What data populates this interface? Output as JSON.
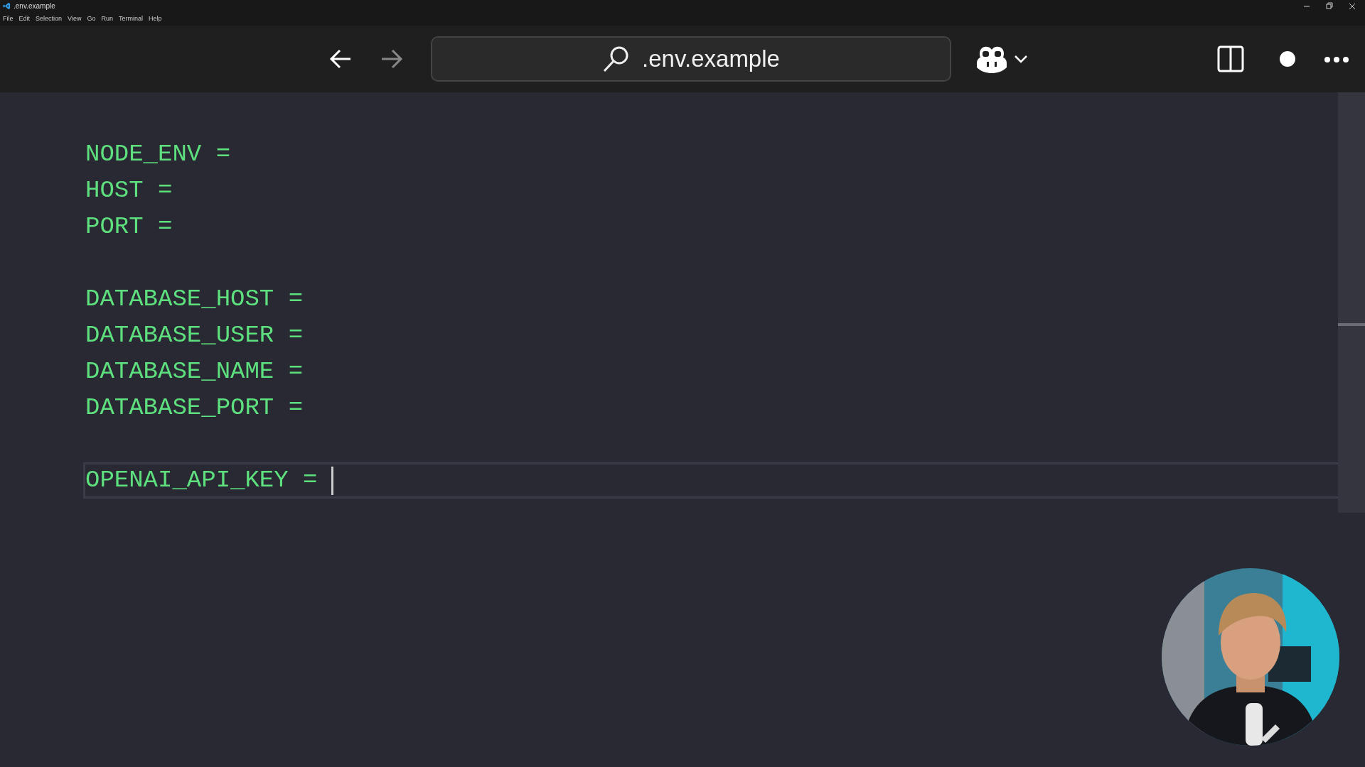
{
  "window": {
    "title": ".env.example"
  },
  "menu": [
    "File",
    "Edit",
    "Selection",
    "View",
    "Go",
    "Run",
    "Terminal",
    "Help"
  ],
  "toolbar": {
    "back": {
      "disabled": false
    },
    "forward": {
      "disabled": true
    },
    "search": {
      "value": ".env.example"
    }
  },
  "editor": {
    "lines": [
      {
        "kind": "code",
        "text": "NODE_ENV =",
        "current": false
      },
      {
        "kind": "code",
        "text": "HOST =",
        "current": false
      },
      {
        "kind": "code",
        "text": "PORT =",
        "current": false
      },
      {
        "kind": "blank"
      },
      {
        "kind": "code",
        "text": "DATABASE_HOST =",
        "current": false
      },
      {
        "kind": "code",
        "text": "DATABASE_USER =",
        "current": false
      },
      {
        "kind": "code",
        "text": "DATABASE_NAME =",
        "current": false
      },
      {
        "kind": "code",
        "text": "DATABASE_PORT =",
        "current": false
      },
      {
        "kind": "blank"
      },
      {
        "kind": "code",
        "text": "OPENAI_API_KEY =",
        "current": true
      }
    ]
  }
}
